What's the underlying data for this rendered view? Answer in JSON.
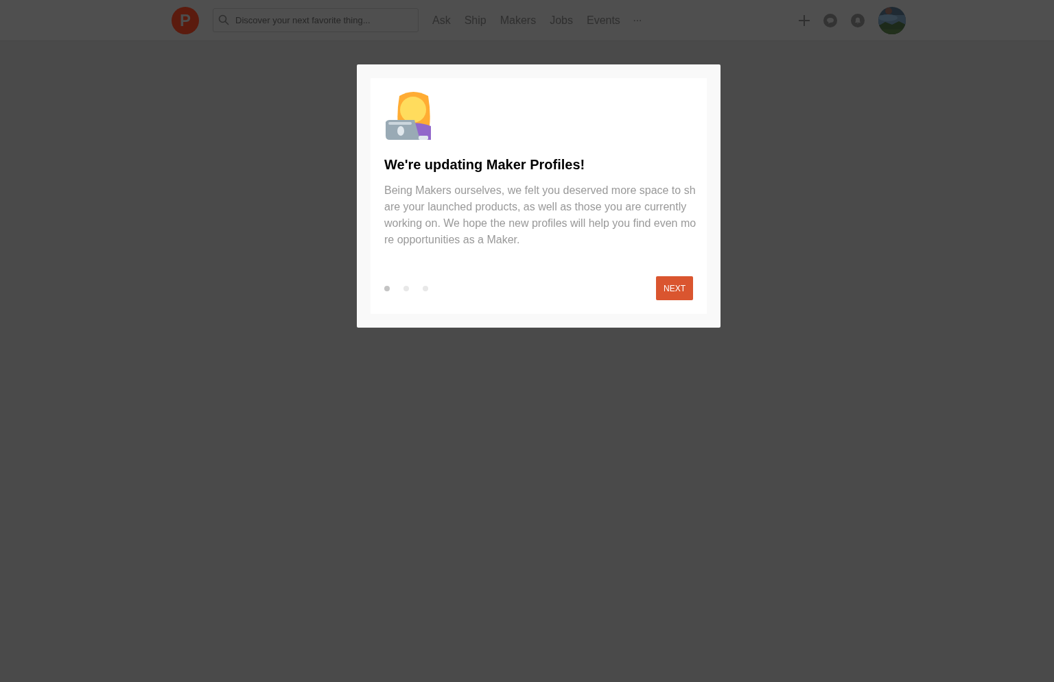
{
  "header": {
    "logo": "P",
    "search": {
      "placeholder": "Discover your next favorite thing..."
    },
    "nav": [
      "Ask",
      "Ship",
      "Makers",
      "Jobs",
      "Events"
    ],
    "more": "···"
  },
  "modal": {
    "title": "We're updating Maker Profiles!",
    "body": "Being Makers ourselves, we felt you deserved more space to share your launched products, as well as those you are currently working on. We hope the new profiles will help you find even more opportunities as a Maker.",
    "dots": [
      {
        "selected": true
      },
      {
        "selected": false
      },
      {
        "selected": false
      }
    ],
    "button": "NEXT"
  }
}
